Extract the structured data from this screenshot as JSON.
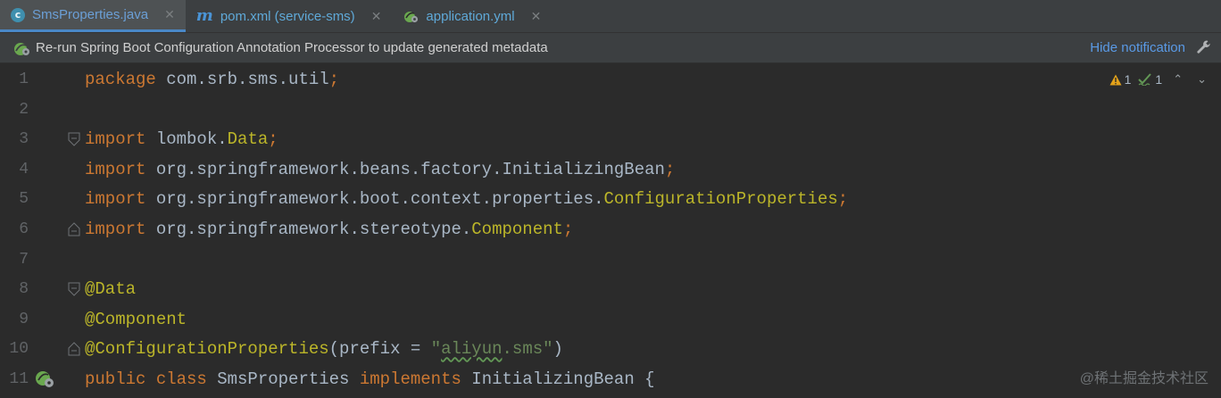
{
  "tabs": [
    {
      "label": "SmsProperties.java",
      "icon": "java-class-icon",
      "active": true
    },
    {
      "label": "pom.xml (service-sms)",
      "icon": "maven-icon",
      "active": false
    },
    {
      "label": "application.yml",
      "icon": "spring-yml-icon",
      "active": false
    }
  ],
  "tab_close_glyph": "✕",
  "notification": {
    "text": "Re-run Spring Boot Configuration Annotation Processor to update generated metadata",
    "link": "Hide notification",
    "icon": "spring-boot-icon",
    "action_icon": "wrench-icon"
  },
  "inspection": {
    "warnings": "1",
    "weak_warnings": "1",
    "up_glyph": "⌃",
    "down_glyph": "⌄"
  },
  "lines": [
    {
      "num": "1",
      "tokens": [
        [
          "kw",
          "package"
        ],
        [
          "pl",
          " com.srb.sms.util"
        ],
        [
          "kw",
          ";"
        ]
      ]
    },
    {
      "num": "2",
      "tokens": []
    },
    {
      "num": "3",
      "tokens": [
        [
          "kw",
          "import"
        ],
        [
          "pl",
          " lombok."
        ],
        [
          "ann",
          "Data"
        ],
        [
          "kw",
          ";"
        ]
      ],
      "fold": "start"
    },
    {
      "num": "4",
      "tokens": [
        [
          "kw",
          "import"
        ],
        [
          "pl",
          " org.springframework.beans.factory.InitializingBean"
        ],
        [
          "kw",
          ";"
        ]
      ]
    },
    {
      "num": "5",
      "tokens": [
        [
          "kw",
          "import"
        ],
        [
          "pl",
          " org.springframework.boot.context.properties."
        ],
        [
          "ann",
          "ConfigurationProperties"
        ],
        [
          "kw",
          ";"
        ]
      ]
    },
    {
      "num": "6",
      "tokens": [
        [
          "kw",
          "import"
        ],
        [
          "pl",
          " org.springframework.stereotype."
        ],
        [
          "ann",
          "Component"
        ],
        [
          "kw",
          ";"
        ]
      ],
      "fold": "end"
    },
    {
      "num": "7",
      "tokens": []
    },
    {
      "num": "8",
      "tokens": [
        [
          "ann",
          "@Data"
        ]
      ],
      "fold": "start"
    },
    {
      "num": "9",
      "tokens": [
        [
          "ann",
          "@Component"
        ]
      ]
    },
    {
      "num": "10",
      "tokens": [
        [
          "ann",
          "@ConfigurationProperties"
        ],
        [
          "pl",
          "(prefix = "
        ],
        [
          "str",
          "\""
        ],
        [
          "strsq",
          "aliyun"
        ],
        [
          "str",
          ".sms\""
        ],
        [
          "pl",
          ")"
        ]
      ],
      "fold": "end"
    },
    {
      "num": "11",
      "tokens": [
        [
          "kw",
          "public class"
        ],
        [
          "pl",
          " SmsProperties "
        ],
        [
          "kw",
          "implements"
        ],
        [
          "pl",
          " InitializingBean {"
        ]
      ],
      "gutter": "spring-bean-icon"
    }
  ],
  "watermark": "@稀土掘金技术社区"
}
